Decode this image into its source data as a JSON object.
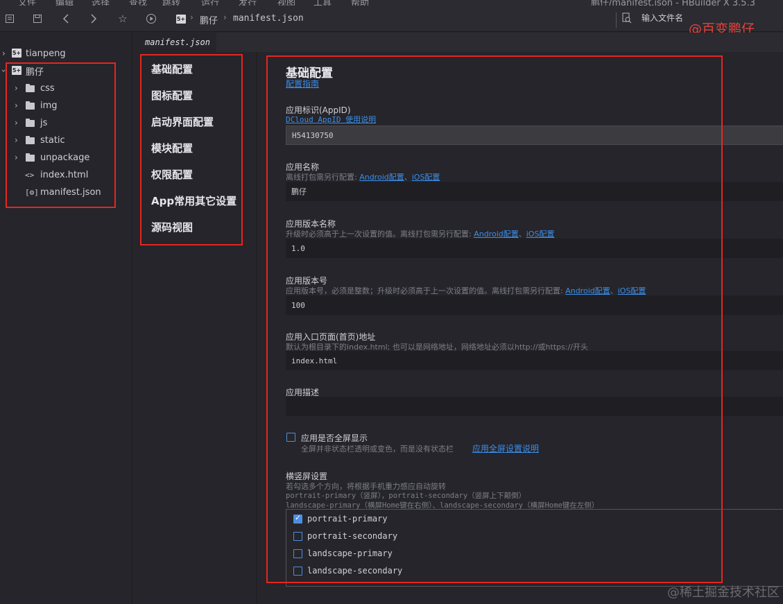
{
  "menubar": {
    "items": [
      "文件",
      "编辑",
      "选择",
      "查找",
      "跳转",
      "运行",
      "发行",
      "视图",
      "工具",
      "帮助"
    ],
    "title": "鹏仔/manifest.json - HBuilder X 3.5.3"
  },
  "toolbar": {
    "breadcrumb_project": "鹏仔",
    "breadcrumb_file": "manifest.json",
    "search_placeholder": "输入文件名"
  },
  "watermarks": {
    "top": "@百变鹏仔",
    "bottom": "@稀土掘金技术社区"
  },
  "explorer": {
    "projects": [
      {
        "label": "tianpeng"
      },
      {
        "label": "鹏仔"
      }
    ],
    "children": [
      {
        "label": "css",
        "type": "folder"
      },
      {
        "label": "img",
        "type": "folder"
      },
      {
        "label": "js",
        "type": "folder"
      },
      {
        "label": "static",
        "type": "folder"
      },
      {
        "label": "unpackage",
        "type": "folder"
      },
      {
        "label": "index.html",
        "type": "html"
      },
      {
        "label": "manifest.json",
        "type": "json"
      }
    ]
  },
  "tabs": [
    {
      "label": "manifest.json"
    }
  ],
  "nav": {
    "items": [
      "基础配置",
      "图标配置",
      "启动界面配置",
      "模块配置",
      "权限配置",
      "App常用其它设置",
      "源码视图"
    ]
  },
  "form": {
    "title": "基础配置",
    "guide_link": "配置指南",
    "appid": {
      "label": "应用标识(AppID)",
      "hint_link": "DCloud AppID 使用说明",
      "value": "H54130750"
    },
    "name": {
      "label": "应用名称",
      "hint": "离线打包需另行配置: ",
      "android_link": "Android配置",
      "sep": "、",
      "ios_link": "iOS配置",
      "value": "鹏仔"
    },
    "version_name": {
      "label": "应用版本名称",
      "hint": "升级时必须高于上一次设置的值。离线打包需另行配置: ",
      "android_link": "Android配置",
      "sep": "、",
      "ios_link": "iOS配置",
      "value": "1.0"
    },
    "version_code": {
      "label": "应用版本号",
      "hint": "应用版本号，必须是整数；升级时必须高于上一次设置的值。离线打包需另行配置: ",
      "android_link": "Android配置",
      "sep": "、",
      "ios_link": "iOS配置",
      "value": "100"
    },
    "entry": {
      "label": "应用入口页面(首页)地址",
      "hint": "默认为根目录下的index.html; 也可以是网络地址，网络地址必须以http://或https://开头",
      "value": "index.html"
    },
    "description": {
      "label": "应用描述",
      "value": ""
    },
    "fullscreen": {
      "label": "应用是否全屏显示",
      "hint": "全屏并非状态栏透明或变色，而是没有状态栏",
      "link": "应用全屏设置说明",
      "checked": false
    },
    "orientation": {
      "label": "横竖屏设置",
      "hint1": "若勾选多个方向，将根据手机重力感应自动旋转",
      "hint2": "portrait-primary（竖屏），portrait-secondary（竖屏上下颠倒）",
      "hint3": "landscape-primary（横屏Home键在右侧）、landscape-secondary（横屏Home键在左侧）",
      "options": [
        {
          "label": "portrait-primary",
          "checked": true
        },
        {
          "label": "portrait-secondary",
          "checked": false
        },
        {
          "label": "landscape-primary",
          "checked": false
        },
        {
          "label": "landscape-secondary",
          "checked": false
        }
      ]
    }
  },
  "colors": {
    "accent": "#3d8ee8",
    "highlight_box": "#e8251f",
    "background": "#25252b"
  }
}
